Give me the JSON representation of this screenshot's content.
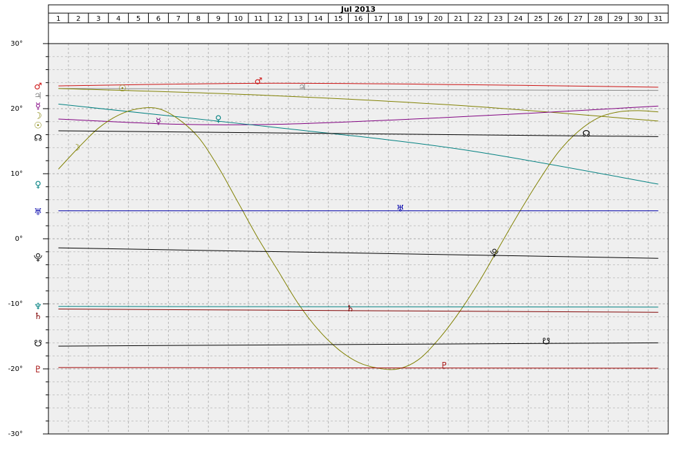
{
  "header": {
    "month": "Jul 2013"
  },
  "chart_data": {
    "type": "line",
    "title": "Jul 2013",
    "x_categories": [
      "1",
      "2",
      "3",
      "4",
      "5",
      "6",
      "7",
      "8",
      "9",
      "10",
      "11",
      "12",
      "13",
      "14",
      "15",
      "16",
      "17",
      "18",
      "19",
      "20",
      "21",
      "22",
      "23",
      "24",
      "25",
      "26",
      "27",
      "28",
      "29",
      "30",
      "31"
    ],
    "x_range": [
      1,
      31
    ],
    "y_range": [
      -30,
      30
    ],
    "y_ticks": [
      30,
      20,
      10,
      0,
      -10,
      -20,
      -30
    ],
    "y_tick_labels": [
      "30°",
      "20°",
      "10°",
      "0°",
      "-10°",
      "-20°",
      "-30°"
    ],
    "grid": true,
    "series": [
      {
        "glyph": "♂",
        "color": "#cc1111",
        "points": [
          [
            1,
            23.5
          ],
          [
            11,
            23.9
          ],
          [
            21,
            23.7
          ],
          [
            31,
            23.3
          ]
        ],
        "label_day": 11.0
      },
      {
        "glyph": "♃",
        "color": "#888888",
        "points": [
          [
            1,
            23.1
          ],
          [
            31,
            22.8
          ]
        ],
        "label_day": 13.2
      },
      {
        "glyph": "☉",
        "color": "#808000",
        "points": [
          [
            1,
            23.1
          ],
          [
            11,
            22.1
          ],
          [
            21,
            20.5
          ],
          [
            31,
            18.1
          ]
        ],
        "label_day": 4.2
      },
      {
        "glyph": "☿",
        "color": "#800080",
        "points": [
          [
            1,
            18.4
          ],
          [
            7,
            17.6
          ],
          [
            12,
            17.6
          ],
          [
            18,
            18.3
          ],
          [
            24,
            19.2
          ],
          [
            31,
            20.4
          ]
        ],
        "label_day": 6.0
      },
      {
        "glyph": "♀",
        "color": "#008080",
        "points": [
          [
            1,
            20.7
          ],
          [
            11,
            17.4
          ],
          [
            21,
            13.8
          ],
          [
            31,
            8.4
          ]
        ],
        "label_day": 9.0
      },
      {
        "glyph": "☽",
        "color": "#808000",
        "points": [
          [
            1,
            10.7
          ],
          [
            2,
            14.0
          ],
          [
            3,
            17.0
          ],
          [
            4,
            19.0
          ],
          [
            5,
            20.0
          ],
          [
            6,
            20.0
          ],
          [
            7,
            18.4
          ],
          [
            8,
            15.6
          ],
          [
            9,
            11.0
          ],
          [
            10,
            5.5
          ],
          [
            11,
            0.0
          ],
          [
            12,
            -5.0
          ],
          [
            13,
            -10.0
          ],
          [
            14,
            -14.0
          ],
          [
            15,
            -17.0
          ],
          [
            16,
            -19.0
          ],
          [
            17,
            -19.9
          ],
          [
            18,
            -20.0
          ],
          [
            19,
            -18.6
          ],
          [
            20,
            -15.5
          ],
          [
            21,
            -11.5
          ],
          [
            22,
            -6.8
          ],
          [
            23,
            -1.5
          ],
          [
            24,
            3.8
          ],
          [
            25,
            8.8
          ],
          [
            26,
            13.3
          ],
          [
            27,
            16.5
          ],
          [
            28,
            18.6
          ],
          [
            29,
            19.5
          ],
          [
            30,
            19.7
          ],
          [
            31,
            19.5
          ]
        ],
        "label_day": 1.9
      },
      {
        "glyph": "☊",
        "color": "#000000",
        "points": [
          [
            1,
            16.6
          ],
          [
            31,
            15.7
          ]
        ],
        "label_day": 27.4
      },
      {
        "glyph": "♅",
        "color": "#0000aa",
        "points": [
          [
            1,
            4.3
          ],
          [
            31,
            4.3
          ]
        ],
        "label_day": 18.1
      },
      {
        "glyph": "⯓",
        "color": "#000000",
        "points": [
          [
            1,
            -1.4
          ],
          [
            31,
            -3.0
          ]
        ],
        "label_day": 22.8
      },
      {
        "glyph": "♆",
        "color": "#008080",
        "points": [
          [
            1,
            -10.4
          ],
          [
            31,
            -10.5
          ]
        ]
      },
      {
        "glyph": "♄",
        "color": "#800000",
        "points": [
          [
            1,
            -10.8
          ],
          [
            31,
            -11.3
          ]
        ],
        "label_day": 15.6
      },
      {
        "glyph": "☋",
        "color": "#000000",
        "points": [
          [
            1,
            -16.5
          ],
          [
            31,
            -16.0
          ]
        ],
        "label_day": 25.4
      },
      {
        "glyph": "♇",
        "color": "#a00000",
        "points": [
          [
            1,
            -19.8
          ],
          [
            31,
            -19.9
          ]
        ],
        "label_day": 20.3
      }
    ],
    "left_legend": [
      {
        "glyph": "♂",
        "color": "#cc1111",
        "y": 23.5
      },
      {
        "glyph": "♃",
        "color": "#888888",
        "y": 22.1
      },
      {
        "glyph": "☿",
        "color": "#800080",
        "y": 20.5
      },
      {
        "glyph": "☽",
        "color": "#808000",
        "y": 19.0
      },
      {
        "glyph": "☉",
        "color": "#808000",
        "y": 17.5
      },
      {
        "glyph": "☊",
        "color": "#000000",
        "y": 15.6
      },
      {
        "glyph": "♀",
        "color": "#008080",
        "y": 8.4
      },
      {
        "glyph": "♅",
        "color": "#0000aa",
        "y": 4.2
      },
      {
        "glyph": "⯓",
        "color": "#000000",
        "y": -2.8
      },
      {
        "glyph": "♆",
        "color": "#008080",
        "y": -10.3
      },
      {
        "glyph": "♄",
        "color": "#800000",
        "y": -11.8
      },
      {
        "glyph": "☋",
        "color": "#000000",
        "y": -16.0
      },
      {
        "glyph": "♇",
        "color": "#a00000",
        "y": -20.0
      }
    ]
  }
}
